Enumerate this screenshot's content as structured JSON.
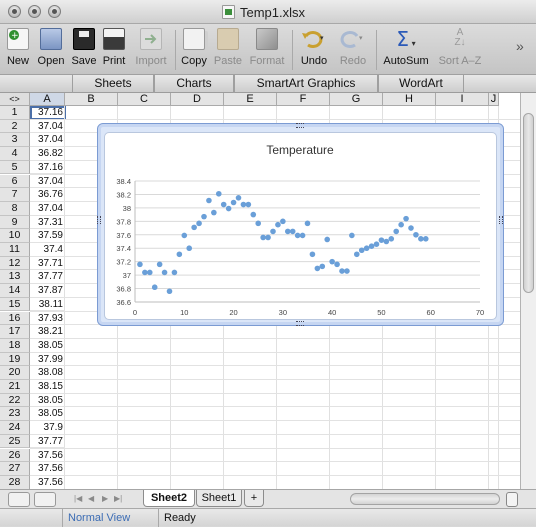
{
  "window": {
    "title": "Temp1.xlsx"
  },
  "toolbar": {
    "items": [
      {
        "label": "New",
        "icon": "new-document-icon",
        "enabled": true
      },
      {
        "label": "Open",
        "icon": "open-folder-icon",
        "enabled": true
      },
      {
        "label": "Save",
        "icon": "save-disk-icon",
        "enabled": true
      },
      {
        "label": "Print",
        "icon": "printer-icon",
        "enabled": true
      },
      {
        "label": "Import",
        "icon": "import-icon",
        "enabled": false
      },
      {
        "label": "Copy",
        "icon": "copy-icon",
        "enabled": true
      },
      {
        "label": "Paste",
        "icon": "paste-icon",
        "enabled": false
      },
      {
        "label": "Format",
        "icon": "format-brush-icon",
        "enabled": false
      },
      {
        "label": "Undo",
        "icon": "undo-icon",
        "enabled": true
      },
      {
        "label": "Redo",
        "icon": "redo-icon",
        "enabled": false
      },
      {
        "label": "AutoSum",
        "icon": "sigma-icon",
        "enabled": true
      },
      {
        "label": "Sort A–Z",
        "icon": "sort-az-icon",
        "enabled": false
      }
    ],
    "overflow": "»"
  },
  "ribbon": {
    "tabs": [
      "Sheets",
      "Charts",
      "SmartArt Graphics",
      "WordArt"
    ]
  },
  "grid": {
    "corner": "<>",
    "columns": [
      "A",
      "B",
      "C",
      "D",
      "E",
      "F",
      "G",
      "H",
      "I",
      "J"
    ],
    "selected_column": "A",
    "rows": [
      {
        "n": "1",
        "a": "37.16"
      },
      {
        "n": "2",
        "a": "37.04"
      },
      {
        "n": "3",
        "a": "37.04"
      },
      {
        "n": "4",
        "a": "36.82"
      },
      {
        "n": "5",
        "a": "37.16"
      },
      {
        "n": "6",
        "a": "37.04"
      },
      {
        "n": "7",
        "a": "36.76"
      },
      {
        "n": "8",
        "a": "37.04"
      },
      {
        "n": "9",
        "a": "37.31"
      },
      {
        "n": "10",
        "a": "37.59"
      },
      {
        "n": "11",
        "a": "37.4"
      },
      {
        "n": "12",
        "a": "37.71"
      },
      {
        "n": "13",
        "a": "37.77"
      },
      {
        "n": "14",
        "a": "37.87"
      },
      {
        "n": "15",
        "a": "38.11"
      },
      {
        "n": "16",
        "a": "37.93"
      },
      {
        "n": "17",
        "a": "38.21"
      },
      {
        "n": "18",
        "a": "38.05"
      },
      {
        "n": "19",
        "a": "37.99"
      },
      {
        "n": "20",
        "a": "38.08"
      },
      {
        "n": "21",
        "a": "38.15"
      },
      {
        "n": "22",
        "a": "38.05"
      },
      {
        "n": "23",
        "a": "38.05"
      },
      {
        "n": "24",
        "a": "37.9"
      },
      {
        "n": "25",
        "a": "37.77"
      },
      {
        "n": "26",
        "a": "37.56"
      },
      {
        "n": "27",
        "a": "37.56"
      },
      {
        "n": "28",
        "a": "37.56"
      }
    ]
  },
  "sheets": {
    "tabs": [
      "Sheet2",
      "Sheet1"
    ],
    "active": "Sheet2",
    "add": "+"
  },
  "status": {
    "view": "Normal View",
    "state": "Ready"
  },
  "colors": {
    "accent": "#4b6fa8",
    "marker": "#6a9fd8",
    "chart_border": "#7b9bd3"
  },
  "chart_data": {
    "type": "scatter",
    "title": "Temperature",
    "xlim": [
      0,
      70
    ],
    "ylim": [
      36.6,
      38.4
    ],
    "x_ticks": [
      0,
      10,
      20,
      30,
      40,
      50,
      60,
      70
    ],
    "y_ticks": [
      36.6,
      36.8,
      37,
      37.2,
      37.4,
      37.6,
      37.8,
      38,
      38.2,
      38.4
    ],
    "grid": "horizontal",
    "series": [
      {
        "x": [
          1,
          2,
          3,
          4,
          5,
          6,
          7,
          8,
          9,
          10,
          11,
          12,
          13,
          14,
          15,
          16,
          17,
          18,
          19,
          20,
          21,
          22,
          23,
          24,
          25,
          26,
          27,
          28,
          29,
          30,
          31,
          32,
          33,
          34,
          35,
          36,
          37,
          38,
          39,
          40,
          41,
          42,
          43,
          44,
          45,
          46,
          47,
          48,
          49,
          50,
          51,
          52,
          53,
          54,
          55,
          56,
          57,
          58,
          59
        ],
        "y": [
          37.16,
          37.04,
          37.04,
          36.82,
          37.16,
          37.04,
          36.76,
          37.04,
          37.31,
          37.59,
          37.4,
          37.71,
          37.77,
          37.87,
          38.11,
          37.93,
          38.21,
          38.05,
          37.99,
          38.08,
          38.15,
          38.05,
          38.05,
          37.9,
          37.77,
          37.56,
          37.56,
          37.65,
          37.75,
          37.8,
          37.65,
          37.65,
          37.59,
          37.59,
          37.77,
          37.31,
          37.1,
          37.13,
          37.53,
          37.2,
          37.16,
          37.06,
          37.06,
          37.59,
          37.31,
          37.37,
          37.4,
          37.43,
          37.46,
          37.52,
          37.5,
          37.54,
          37.65,
          37.75,
          37.84,
          37.7,
          37.6,
          37.54,
          37.54
        ]
      }
    ]
  }
}
